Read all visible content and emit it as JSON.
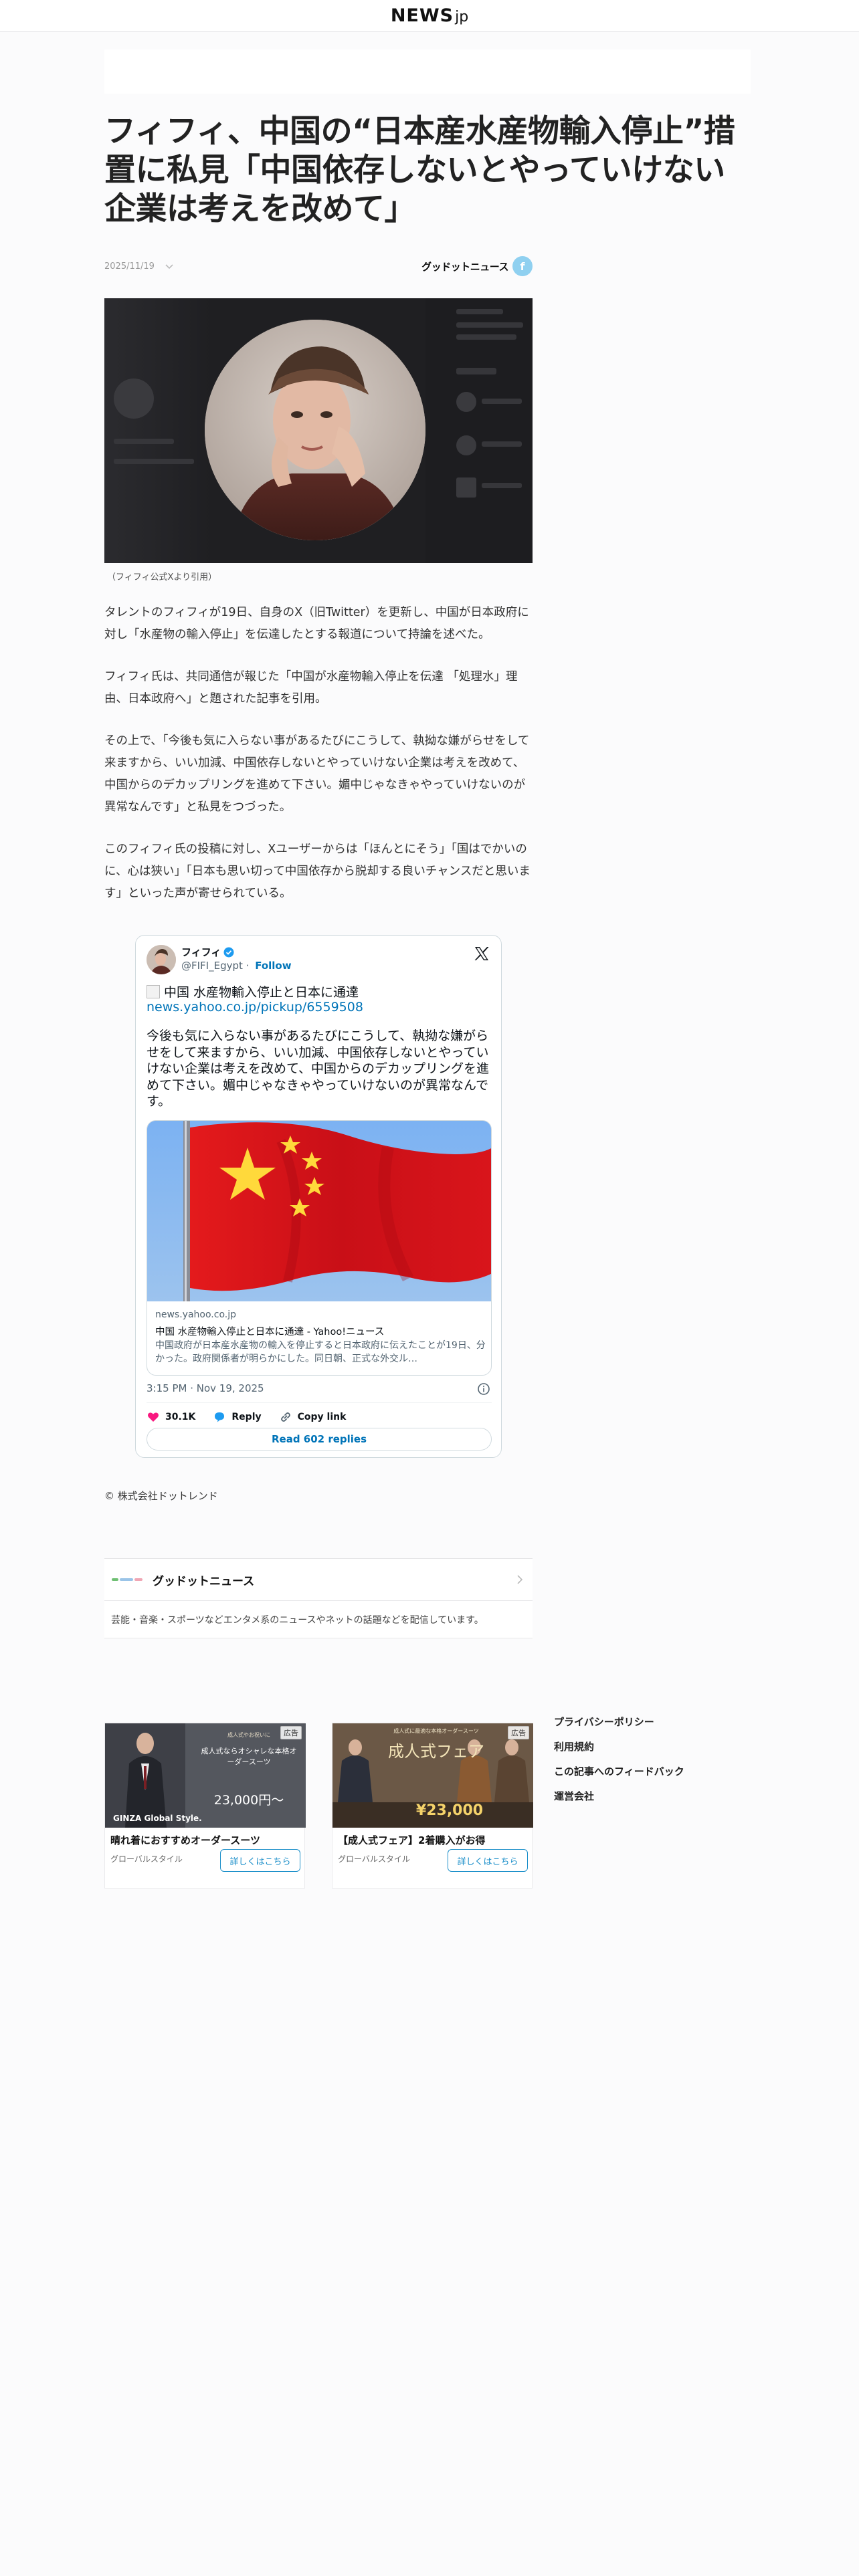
{
  "header": {
    "logo_main": "NEWS",
    "logo_sub": "jp"
  },
  "article": {
    "title": "フィフィ、中国の“日本産水産物輸入停止”措置に私見「中国依存しないとやっていけない企業は考えを改めて」",
    "date": "2025/11/19",
    "source_badge": "グッドットニュース",
    "image_caption": "（フィフィ公式Xより引用）",
    "paragraphs": [
      "タレントのフィフィが19日、自身のX（旧Twitter）を更新し、中国が日本政府に対し「水産物の輸入停止」を伝達したとする報道について持論を述べた。",
      "フィフィ氏は、共同通信が報じた「中国が水産物輸入停止を伝達 「処理水」理由、日本政府へ」と題された記事を引用。",
      "その上で、「今後も気に入らない事があるたびにこうして、執拗な嫌がらせをして来ますから、いい加減、中国依存しないとやっていけない企業は考えを改めて、中国からのデカップリングを進めて下さい。媚中じゃなきゃやっていけないのが異常なんです」と私見をつづった。",
      "このフィフィ氏の投稿に対し、Xユーザーからは「ほんとにそう」「国はでかいのに、心は狭い」「日本も思い切って中国依存から脱却する良いチャンスだと思います」といった声が寄せられている。"
    ],
    "copyright": "© 株式会社ドットレンド"
  },
  "tweet": {
    "author_name": "フィフィ",
    "handle": "@FIFI_Egypt",
    "separator": " · ",
    "follow_label": "Follow",
    "headline": "中国 水産物輸入停止と日本に通達",
    "link": "news.yahoo.co.jp/pickup/6559508",
    "text": "今後も気に入らない事があるたびにこうして、執拗な嫌がらせをして来ますから、いい加減、中国依存しないとやっていけない企業は考えを改めて、中国からのデカップリングを進めて下さい。媚中じゃなきゃやっていけないのが異常なんです。",
    "card_domain": "news.yahoo.co.jp",
    "card_title": "中国 水産物輸入停止と日本に通達 - Yahoo!ニュース",
    "card_description": "中国政府が日本産水産物の輸入を停止すると日本政府に伝えたことが19日、分かった。政府関係者が明らかにした。同日朝、正式な外交ル…",
    "timestamp": "3:15 PM · Nov 19, 2025",
    "like_count": "30.1K",
    "reply_label": "Reply",
    "copy_link_label": "Copy link",
    "read_replies_label": "Read 602 replies"
  },
  "source": {
    "logo_text": "グッドットニュース",
    "name": "グッドットニュース",
    "description": "芸能・音楽・スポーツなどエンタメ系のニュースやネットの話題などを配信しています。"
  },
  "ads": [
    {
      "label": "広告",
      "title": "晴れ着におすすめオーダースーツ",
      "advertiser": "グローバルスタイル",
      "cta": "詳しくはこちら",
      "img_caption": "成人式やお祝いに",
      "img_heading": "成人式ならオシャレな本格オーダースーツ",
      "img_brand": "GINZA Global Style.",
      "img_price": "23,000円〜"
    },
    {
      "label": "広告",
      "title": "【成人式フェア】2着購入がお得",
      "advertiser": "グローバルスタイル",
      "cta": "詳しくはこちら",
      "img_caption": "成人式に最適な本格オーダースーツ",
      "img_heading": "成人式フェア",
      "img_price": "¥23,000"
    }
  ],
  "side_links": [
    "プライバシーポリシー",
    "利用規約",
    "この記事へのフィードバック",
    "運営会社"
  ],
  "colors": {
    "link": "#0074b8",
    "like": "#f91880",
    "reply": "#1d9bf0",
    "flag_red": "#d8141c",
    "flag_star": "#ffd93b"
  }
}
